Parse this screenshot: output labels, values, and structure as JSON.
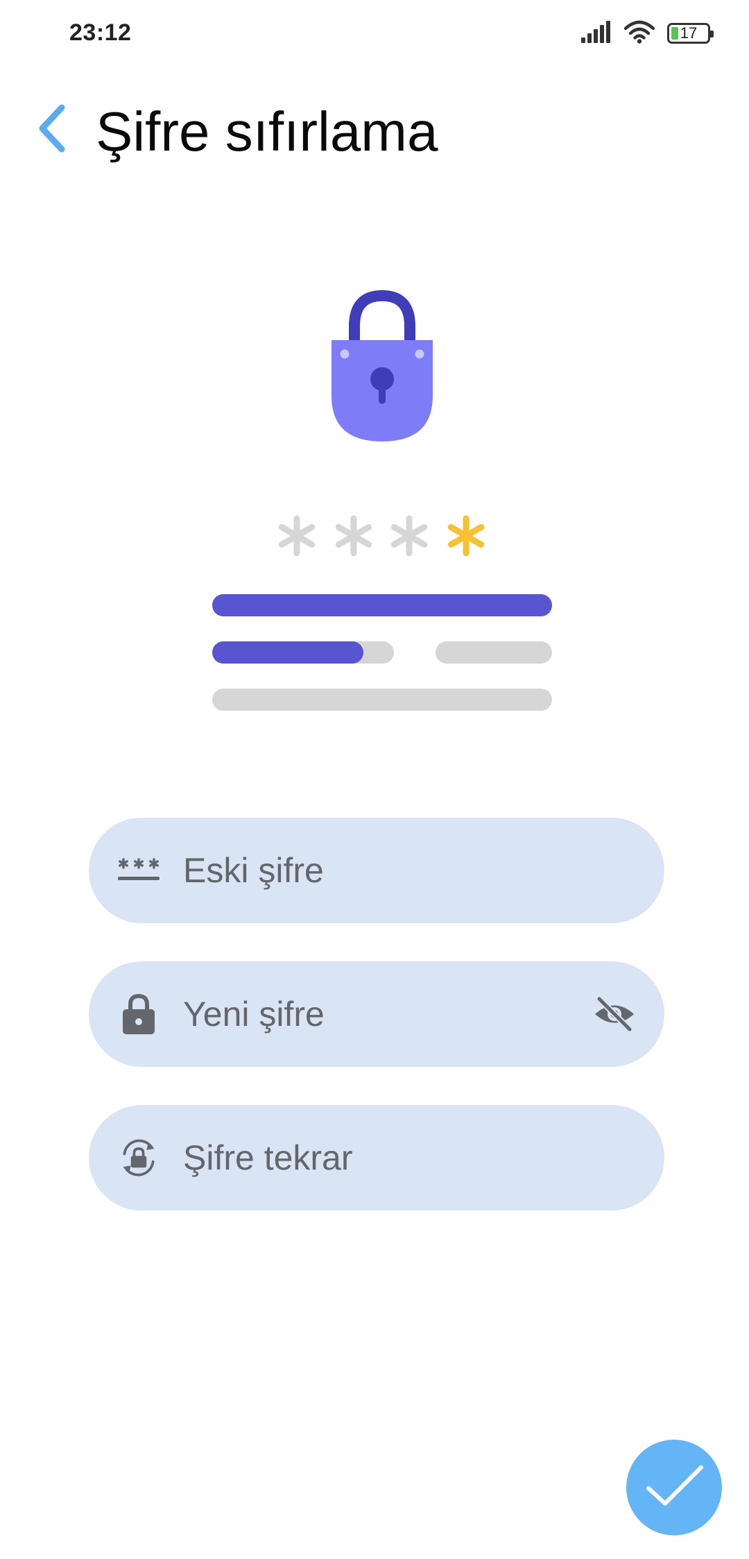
{
  "status_bar": {
    "time": "23:12",
    "battery_level": "17",
    "icons": [
      "signal-icon",
      "wifi-icon",
      "battery-icon"
    ]
  },
  "header": {
    "back_icon": "chevron-left-icon",
    "title": "Şifre sıfırlama"
  },
  "illustration": {
    "icon": "padlock-icon",
    "password_mask": [
      "*",
      "*",
      "*",
      "*"
    ]
  },
  "form": {
    "old_password": {
      "placeholder": "Eski şifre",
      "value": "",
      "icon": "password-dots-icon"
    },
    "new_password": {
      "placeholder": "Yeni şifre",
      "value": "",
      "icon": "lock-icon",
      "toggle_icon": "eye-off-icon"
    },
    "repeat_password": {
      "placeholder": "Şifre tekrar",
      "value": "",
      "icon": "lock-reset-icon"
    }
  },
  "fab": {
    "icon": "checkmark-icon"
  },
  "colors": {
    "accent": "#64b5f6",
    "back_arrow": "#5aabf2",
    "lock_body": "#7e7cf7",
    "lock_shackle": "#3f3db8",
    "progress": "#5955d1",
    "track": "#d6d6d6",
    "highlight_star": "#f6c132",
    "field_bg": "#d9e4f5",
    "field_text": "#63666b"
  }
}
